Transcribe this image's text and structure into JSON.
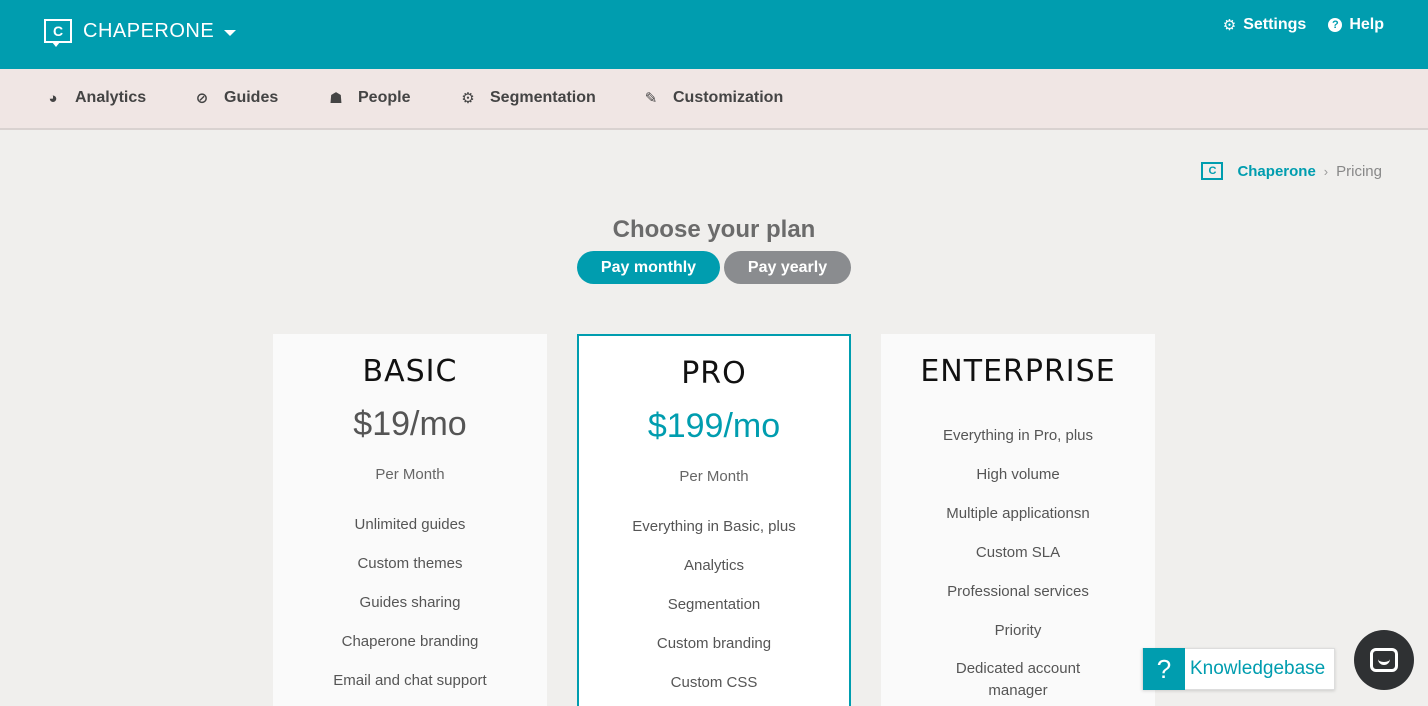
{
  "topbar": {
    "brand_logo_letter": "C",
    "brand_name": "CHAPERONE",
    "settings_label": "Settings",
    "help_label": "Help",
    "help_icon_glyph": "?"
  },
  "nav": [
    {
      "label": "Analytics",
      "icon": "dashboard-icon"
    },
    {
      "label": "Guides",
      "icon": "compass-icon"
    },
    {
      "label": "People",
      "icon": "users-icon"
    },
    {
      "label": "Segmentation",
      "icon": "gear-icon"
    },
    {
      "label": "Customization",
      "icon": "pencil-icon"
    }
  ],
  "breadcrumb": {
    "logo_letter": "C",
    "home": "Chaperone",
    "separator": "›",
    "current": "Pricing"
  },
  "pricing": {
    "title": "Choose your plan",
    "toggle": {
      "monthly": "Pay monthly",
      "yearly": "Pay yearly",
      "selected": "monthly"
    },
    "plans": [
      {
        "name": "BASIC",
        "price": "$19/mo",
        "period": "Per Month",
        "features": [
          "Unlimited guides",
          "Custom themes",
          "Guides sharing",
          "Chaperone branding",
          "Email and chat support"
        ]
      },
      {
        "name": "PRO",
        "price": "$199/mo",
        "period": "Per Month",
        "features": [
          "Everything in Basic, plus",
          "Analytics",
          "Segmentation",
          "Custom branding",
          "Custom CSS"
        ]
      },
      {
        "name": "ENTERPRISE",
        "features": [
          "Everything in Pro, plus",
          "High volume",
          "Multiple applicationsn",
          "Custom SLA",
          "Professional services",
          "Priority",
          "Dedicated account manager"
        ]
      }
    ]
  },
  "widgets": {
    "knowledgebase_icon": "?",
    "knowledgebase_label": "Knowledgebase"
  },
  "colors": {
    "primary": "#009daf",
    "nav_bg": "#f0e6e4",
    "page_bg": "#f0efed",
    "toggle_inactive": "#8a8c8f"
  }
}
